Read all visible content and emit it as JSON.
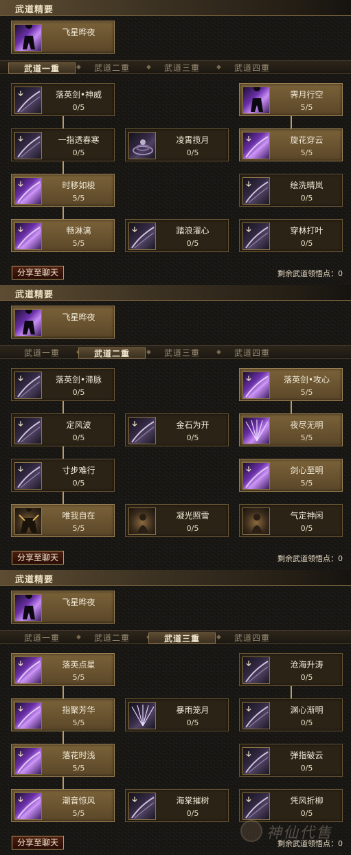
{
  "panels": [
    {
      "header": "武道精要",
      "top_skill": {
        "name": "飞星晔夜"
      },
      "tabs": [
        "武道一重",
        "武道二重",
        "武道三重",
        "武道四重"
      ],
      "active_tab": 0,
      "skills": [
        {
          "name": "落英剑•神威",
          "level": "0/5",
          "col": 0,
          "row": 0,
          "lit": false,
          "icon": "sword-slash-icon"
        },
        {
          "name": "霁月行空",
          "level": "5/5",
          "col": 2,
          "row": 0,
          "lit": true,
          "icon": "shadow-figure-icon"
        },
        {
          "name": "一指透春寒",
          "level": "0/5",
          "col": 0,
          "row": 1,
          "lit": false,
          "icon": "sword-slash-icon"
        },
        {
          "name": "凌霄揽月",
          "level": "0/5",
          "col": 1,
          "row": 1,
          "lit": false,
          "icon": "vortex-icon"
        },
        {
          "name": "旋花穿云",
          "level": "5/5",
          "col": 2,
          "row": 1,
          "lit": true,
          "icon": "sword-slash-icon"
        },
        {
          "name": "时移如梭",
          "level": "5/5",
          "col": 0,
          "row": 2,
          "lit": true,
          "icon": "sword-slash-icon"
        },
        {
          "name": "绘洗晴岚",
          "level": "0/5",
          "col": 2,
          "row": 2,
          "lit": false,
          "icon": "sword-slash-icon"
        },
        {
          "name": "畅淋漓",
          "level": "5/5",
          "col": 0,
          "row": 3,
          "lit": true,
          "icon": "sword-slash-icon"
        },
        {
          "name": "踏浪濯心",
          "level": "0/5",
          "col": 1,
          "row": 3,
          "lit": false,
          "icon": "sword-slash-icon"
        },
        {
          "name": "穿林打叶",
          "level": "0/5",
          "col": 2,
          "row": 3,
          "lit": false,
          "icon": "sword-slash-icon"
        }
      ],
      "share_label": "分享至聊天",
      "remaining_label": "剩余武道领悟点：0"
    },
    {
      "header": "武道精要",
      "top_skill": {
        "name": "飞星晔夜"
      },
      "tabs": [
        "武道一重",
        "武道二重",
        "武道三重",
        "武道四重"
      ],
      "active_tab": 1,
      "skills": [
        {
          "name": "落英剑•滞脉",
          "level": "0/5",
          "col": 0,
          "row": 0,
          "lit": false,
          "icon": "sword-slash-icon"
        },
        {
          "name": "落英剑•攻心",
          "level": "5/5",
          "col": 2,
          "row": 0,
          "lit": true,
          "icon": "sword-slash-icon"
        },
        {
          "name": "定风波",
          "level": "0/5",
          "col": 0,
          "row": 1,
          "lit": false,
          "icon": "sword-slash-icon"
        },
        {
          "name": "金石为开",
          "level": "0/5",
          "col": 1,
          "row": 1,
          "lit": false,
          "icon": "sword-slash-icon"
        },
        {
          "name": "夜尽无明",
          "level": "5/5",
          "col": 2,
          "row": 1,
          "lit": true,
          "icon": "burst-icon"
        },
        {
          "name": "寸步难行",
          "level": "0/5",
          "col": 0,
          "row": 2,
          "lit": false,
          "icon": "sword-slash-icon"
        },
        {
          "name": "剑心至明",
          "level": "5/5",
          "col": 2,
          "row": 2,
          "lit": true,
          "icon": "sword-slash-icon"
        },
        {
          "name": "唯我自在",
          "level": "5/5",
          "col": 0,
          "row": 3,
          "lit": true,
          "icon": "warrior-icon"
        },
        {
          "name": "凝光照雪",
          "level": "0/5",
          "col": 1,
          "row": 3,
          "lit": false,
          "icon": "figure-icon"
        },
        {
          "name": "气定神闲",
          "level": "0/5",
          "col": 2,
          "row": 3,
          "lit": false,
          "icon": "figure-icon"
        }
      ],
      "share_label": "分享至聊天",
      "remaining_label": "剩余武道领悟点：0"
    },
    {
      "header": "武道精要",
      "top_skill": {
        "name": "飞星晔夜"
      },
      "tabs": [
        "武道一重",
        "武道二重",
        "武道三重",
        "武道四重"
      ],
      "active_tab": 2,
      "skills": [
        {
          "name": "落英点星",
          "level": "5/5",
          "col": 0,
          "row": 0,
          "lit": true,
          "icon": "sword-slash-icon"
        },
        {
          "name": "沧海升涛",
          "level": "0/5",
          "col": 2,
          "row": 0,
          "lit": false,
          "icon": "sword-slash-icon"
        },
        {
          "name": "指聚芳华",
          "level": "5/5",
          "col": 0,
          "row": 1,
          "lit": true,
          "icon": "sword-slash-icon"
        },
        {
          "name": "暴雨笼月",
          "level": "0/5",
          "col": 1,
          "row": 1,
          "lit": false,
          "icon": "burst-icon"
        },
        {
          "name": "渊心渐明",
          "level": "0/5",
          "col": 2,
          "row": 1,
          "lit": false,
          "icon": "sword-slash-icon"
        },
        {
          "name": "落花时浅",
          "level": "5/5",
          "col": 0,
          "row": 2,
          "lit": true,
          "icon": "sword-slash-icon"
        },
        {
          "name": "弹指破云",
          "level": "0/5",
          "col": 2,
          "row": 2,
          "lit": false,
          "icon": "sword-slash-icon"
        },
        {
          "name": "潮音惊风",
          "level": "5/5",
          "col": 0,
          "row": 3,
          "lit": true,
          "icon": "sword-slash-icon"
        },
        {
          "name": "海棠摧树",
          "level": "0/5",
          "col": 1,
          "row": 3,
          "lit": false,
          "icon": "sword-slash-icon"
        },
        {
          "name": "凭风折柳",
          "level": "0/5",
          "col": 2,
          "row": 3,
          "lit": false,
          "icon": "sword-slash-icon"
        }
      ],
      "share_label": "分享至聊天",
      "remaining_label": "剩余武道领悟点：0"
    }
  ],
  "watermark": {
    "text": "神仙代售",
    "icon": "mascot-logo-icon"
  }
}
